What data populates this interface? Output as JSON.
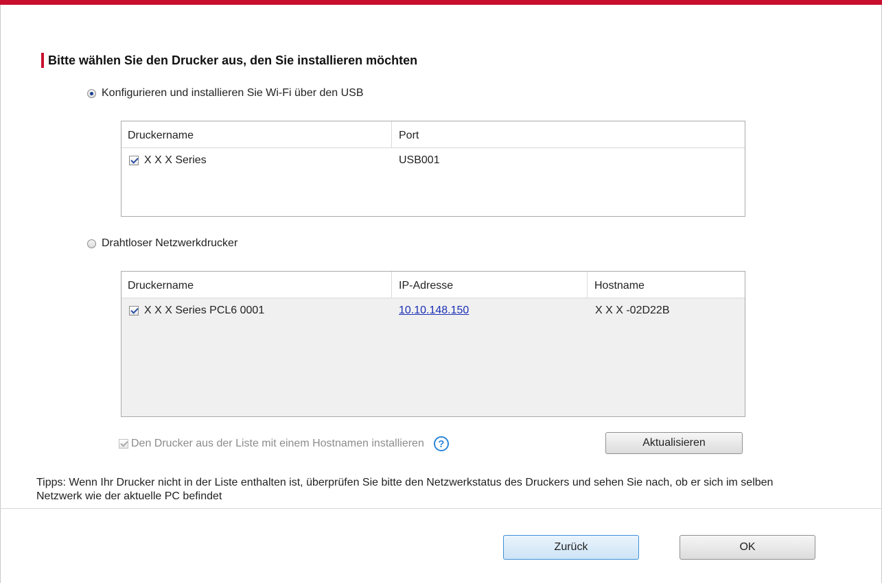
{
  "heading": "Bitte wählen Sie den Drucker aus, den Sie installieren möchten",
  "options": {
    "usb_label": "Konfigurieren und installieren Sie Wi-Fi über den USB",
    "usb_selected": true,
    "wireless_label": "Drahtloser Netzwerkdrucker",
    "wireless_selected": false
  },
  "usb_table": {
    "headers": [
      "Druckername",
      "Port"
    ],
    "rows": [
      {
        "checked": true,
        "name": "X X X  Series",
        "port": "USB001"
      }
    ]
  },
  "wireless_table": {
    "headers": [
      "Druckername",
      "IP-Adresse",
      "Hostname"
    ],
    "rows": [
      {
        "checked": true,
        "name": "X X X  Series PCL6 0001",
        "ip": "10.10.148.150",
        "hostname": "X X X -02D22B"
      }
    ]
  },
  "hostname_option": {
    "label": "Den Drucker aus der Liste mit einem Hostnamen installieren",
    "checked": true,
    "disabled": true,
    "help_glyph": "?"
  },
  "buttons": {
    "refresh": "Aktualisieren",
    "back": "Zurück",
    "ok": "OK"
  },
  "tips": "Tipps: Wenn Ihr Drucker nicht in der Liste enthalten ist, überprüfen Sie bitte den Netzwerkstatus des Druckers und sehen Sie nach, ob er sich im selben Netzwerk wie der aktuelle PC befindet",
  "colors": {
    "accent_red": "#c8102e",
    "link_blue": "#1a2fb5",
    "help_blue": "#2c86d8"
  }
}
